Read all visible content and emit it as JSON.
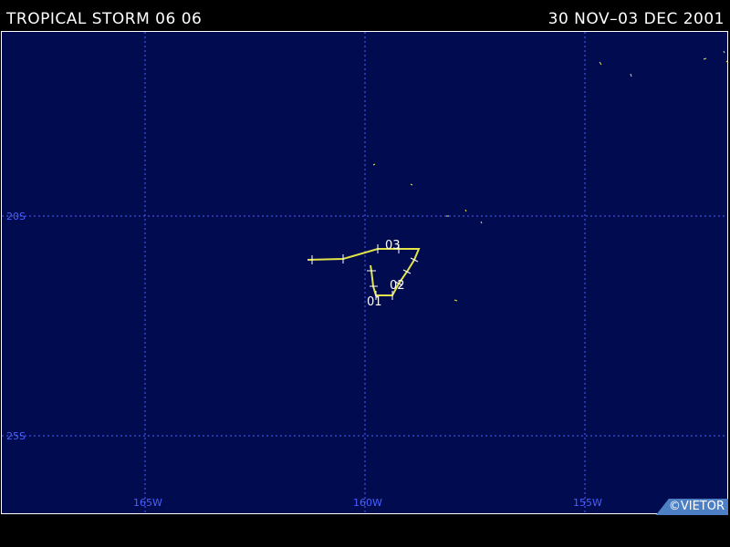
{
  "header": {
    "title": "TROPICAL STORM 06 06",
    "date_range": "30 NOV–03 DEC 2001"
  },
  "map": {
    "longitude_labels": [
      "165W",
      "160W",
      "155W"
    ],
    "latitude_labels": [
      "20S",
      "25S"
    ],
    "colors": {
      "ocean": "#000c4f",
      "grid": "#4a5fff",
      "track": "#e3e34a",
      "coast": "#e3e34a",
      "day_labels": "#ffffff"
    }
  },
  "track": {
    "day_labels": [
      "01",
      "02",
      "03"
    ]
  },
  "credit": "©VIETOR"
}
